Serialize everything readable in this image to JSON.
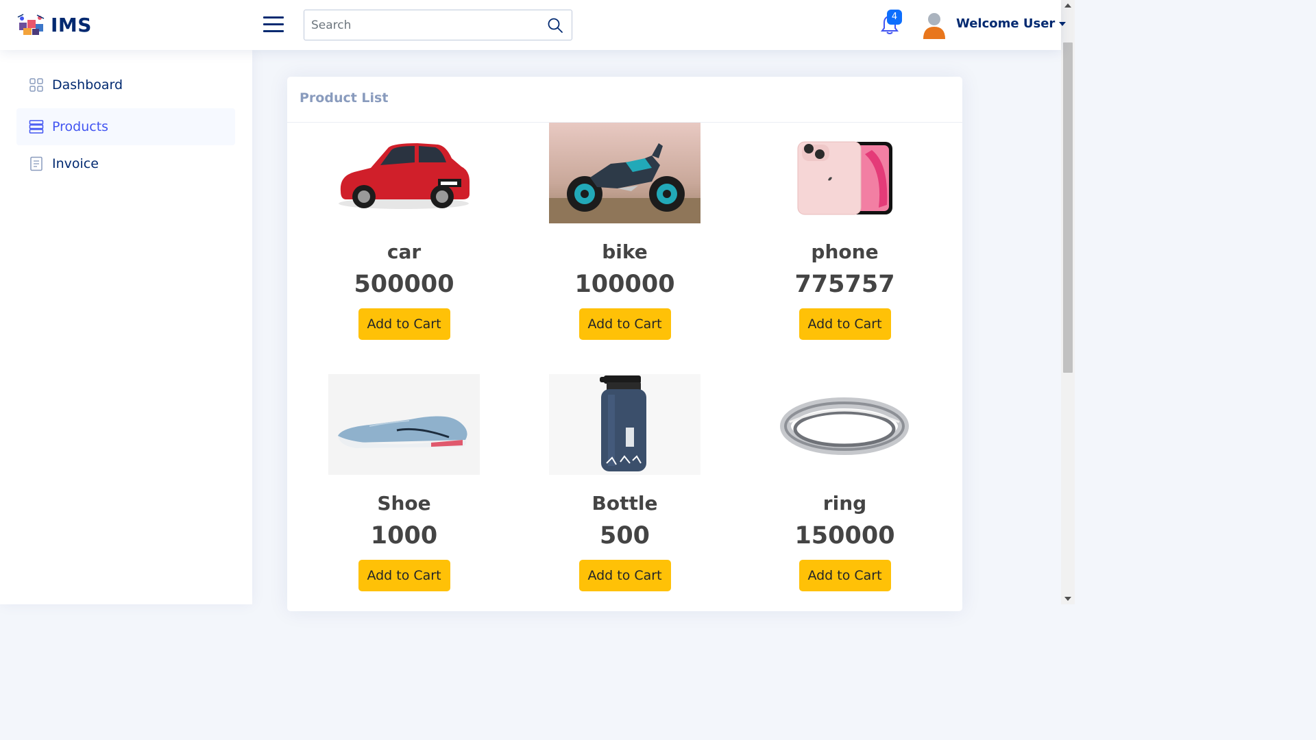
{
  "app": {
    "logo_text": "IMS"
  },
  "header": {
    "search": {
      "placeholder": "Search",
      "value": ""
    },
    "notifications": {
      "count": "4"
    },
    "user": {
      "name": "Welcome User"
    }
  },
  "sidebar": {
    "items": [
      {
        "label": "Dashboard",
        "icon": "grid-icon",
        "active": false
      },
      {
        "label": "Products",
        "icon": "layers-icon",
        "active": true
      },
      {
        "label": "Invoice",
        "icon": "journal-text-icon",
        "active": false
      }
    ]
  },
  "main": {
    "title": "Product List",
    "products": [
      {
        "name": "car",
        "price": "500000",
        "button": "Add to Cart",
        "image": "red-car-image"
      },
      {
        "name": "bike",
        "price": "100000",
        "button": "Add to Cart",
        "image": "motorbike-image"
      },
      {
        "name": "phone",
        "price": "775757",
        "button": "Add to Cart",
        "image": "pink-phone-image"
      },
      {
        "name": "Shoe",
        "price": "1000",
        "button": "Add to Cart",
        "image": "blue-shoe-image"
      },
      {
        "name": "Bottle",
        "price": "500",
        "button": "Add to Cart",
        "image": "navy-bottle-image"
      },
      {
        "name": "ring",
        "price": "150000",
        "button": "Add to Cart",
        "image": "silver-ring-image"
      }
    ]
  },
  "colors": {
    "brand": "#012970",
    "active_nav": "#4154f1",
    "button": "#ffc107",
    "badge": "#0d6efd",
    "card_title": "#899bbd",
    "background": "#f3f6fb"
  }
}
